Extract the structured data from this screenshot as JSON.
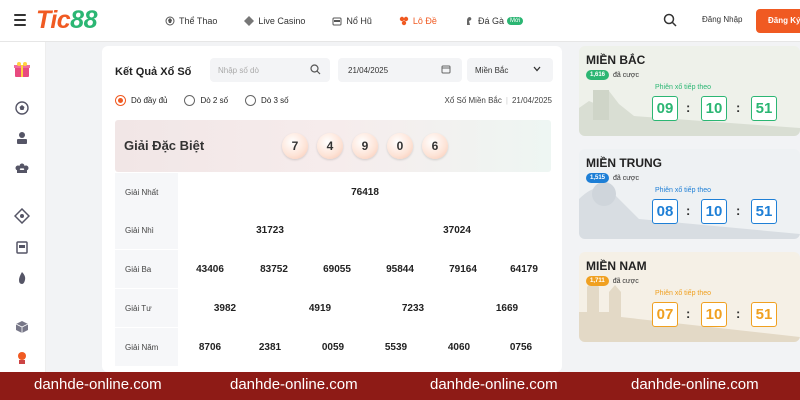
{
  "header": {
    "logo": {
      "part1": "Tic",
      "part2": "88"
    },
    "nav": [
      {
        "label": "Thể Thao",
        "icon": "sports-icon",
        "active": false
      },
      {
        "label": "Live Casino",
        "icon": "casino-icon",
        "active": false
      },
      {
        "label": "Nổ Hũ",
        "icon": "slot-icon",
        "active": false
      },
      {
        "label": "Lô Đề",
        "icon": "lottery-icon",
        "active": true
      },
      {
        "label": "Đá Gà",
        "icon": "cockfight-icon",
        "active": false,
        "badge": "Mới"
      }
    ],
    "login_label": "Đăng Nhập",
    "register_label": "Đăng Ký"
  },
  "sidebar": {
    "icons": [
      "gift-icon",
      "football-icon",
      "dealer-icon",
      "cards-icon",
      "game-icon",
      "slot-machine-icon",
      "fire-icon",
      "cube-icon",
      "lottery-icon"
    ]
  },
  "results": {
    "title": "Kết Quả Xổ Số",
    "search_placeholder": "Nhập số dò",
    "date": "21/04/2025",
    "region": "Miền Bắc",
    "radio_options": [
      {
        "label": "Dò đầy đủ",
        "checked": true
      },
      {
        "label": "Dò 2 số",
        "checked": false
      },
      {
        "label": "Dò 3 số",
        "checked": false
      }
    ],
    "meta_region": "Xổ Số Miền Bắc",
    "meta_date": "21/04/2025",
    "special": {
      "label": "Giải Đặc Biệt",
      "digits": [
        "7",
        "4",
        "9",
        "0",
        "6"
      ]
    },
    "prizes": [
      {
        "label": "Giải Nhất",
        "values": [
          "76418"
        ]
      },
      {
        "label": "Giải Nhì",
        "values": [
          "31723",
          "37024"
        ]
      },
      {
        "label": "Giải Ba",
        "values": [
          "43406",
          "83752",
          "69055",
          "95844",
          "79164",
          "64179"
        ]
      },
      {
        "label": "Giải Tư",
        "values": [
          "3982",
          "4919",
          "7233",
          "1669"
        ]
      },
      {
        "label": "Giải Năm",
        "values": [
          "8706",
          "2381",
          "0059",
          "5539",
          "4060",
          "0756"
        ]
      }
    ]
  },
  "regions": [
    {
      "name": "MIỀN BẮC",
      "count": "1,616",
      "count_suffix": "đã cược",
      "next_label": "Phiên xổ tiếp theo",
      "hh": "09",
      "mm": "10",
      "ss": "51",
      "accent": "#2bb673",
      "pill_color": "#2bb673",
      "bg": "#eef1ea"
    },
    {
      "name": "MIỀN TRUNG",
      "count": "1,515",
      "count_suffix": "đã cược",
      "next_label": "Phiên xổ tiếp theo",
      "hh": "08",
      "mm": "10",
      "ss": "51",
      "accent": "#1e7fd6",
      "pill_color": "#1e7fd6",
      "bg": "#eef1f3"
    },
    {
      "name": "MIỀN NAM",
      "count": "1,711",
      "count_suffix": "đã cược",
      "next_label": "Phiên xổ tiếp theo",
      "hh": "07",
      "mm": "10",
      "ss": "51",
      "accent": "#f0a020",
      "pill_color": "#f0a020",
      "bg": "#f5f0e6"
    }
  ],
  "watermark": [
    "danhde-online.com",
    "danhde-online.com",
    "danhde-online.com",
    "danhde-online.com"
  ],
  "colors": {
    "brand_orange": "#f05a22",
    "brand_green": "#2bb673",
    "footer": "#8e1b16"
  }
}
